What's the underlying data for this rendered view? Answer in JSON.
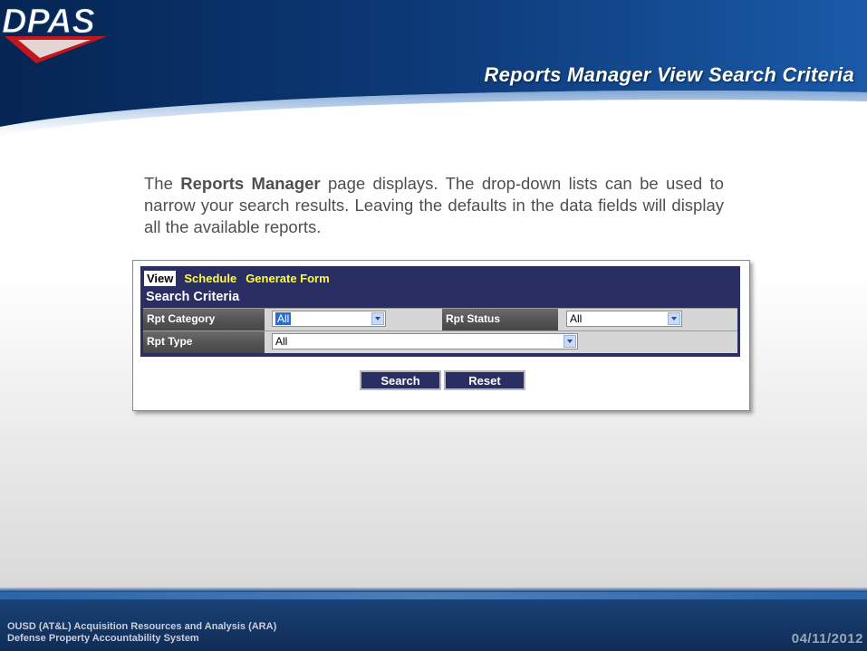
{
  "slide": {
    "title": "Reports Manager View Search Criteria",
    "logo_text": "DPAS"
  },
  "description": {
    "prefix": "The ",
    "bold": "Reports Manager",
    "suffix": " page displays. The drop-down lists can be used to narrow your search results. Leaving the defaults in the data fields will display all the available reports."
  },
  "screenshot": {
    "tabs": [
      "View",
      "Schedule",
      "Generate Form"
    ],
    "panel_title": "Search Criteria",
    "fields": {
      "rpt_category_label": "Rpt Category",
      "rpt_category_value": "All",
      "rpt_status_label": "Rpt Status",
      "rpt_status_value": "All",
      "rpt_type_label": "Rpt Type",
      "rpt_type_value": "All"
    },
    "buttons": {
      "search": "Search",
      "reset": "Reset"
    }
  },
  "footer": {
    "org_line1": "OUSD (AT&L) Acquisition Resources and Analysis (ARA)",
    "org_line2": "Defense Property Accountability System",
    "date": "04/11/2012"
  },
  "colors": {
    "header_blue": "#0b2f63",
    "panel_navy": "#2b2e63",
    "tab_yellow": "#ffff33",
    "logo_red": "#c4161c"
  }
}
